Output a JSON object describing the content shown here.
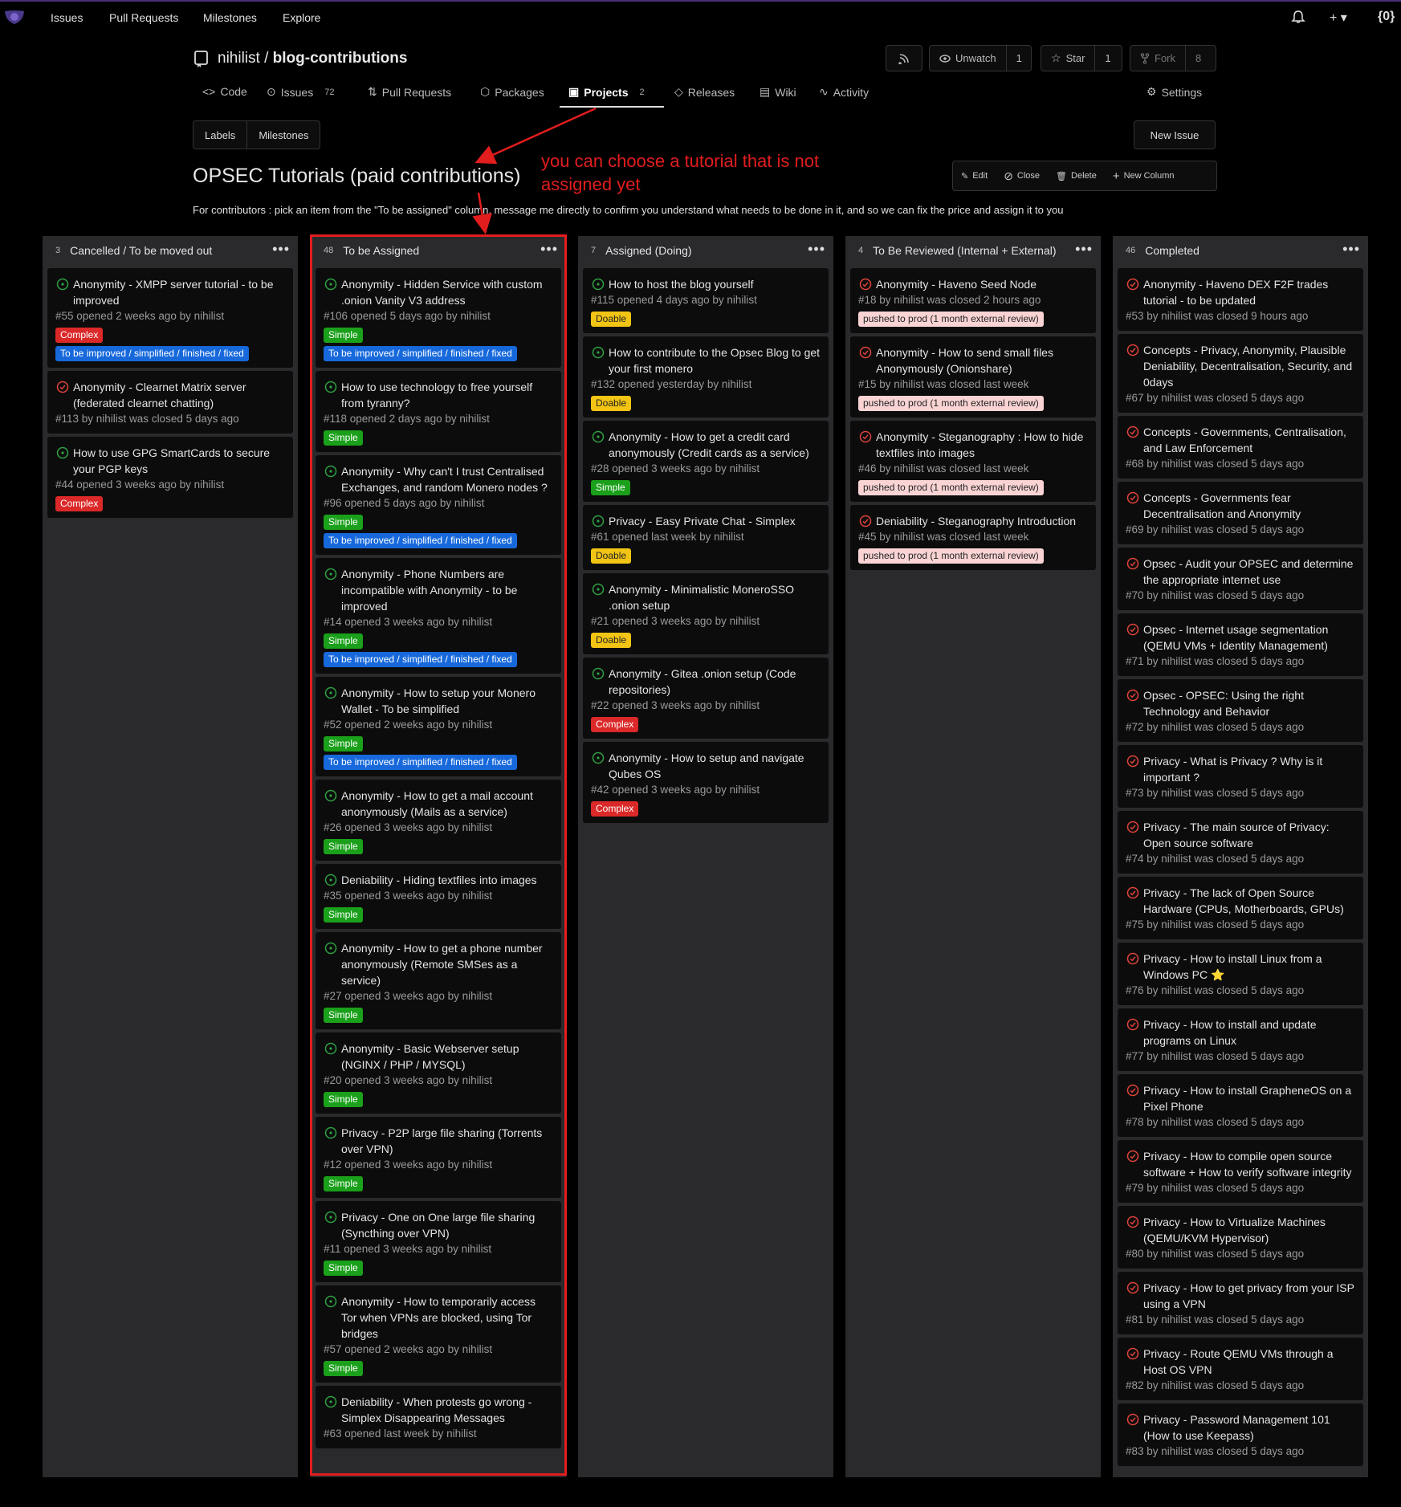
{
  "nav": {
    "items": [
      "Issues",
      "Pull Requests",
      "Milestones",
      "Explore"
    ],
    "right": {
      "bell": "bell-icon",
      "plus": "+ ▾",
      "profile": "{0}"
    }
  },
  "repo": {
    "owner": "nihilist",
    "name": "blog-contributions",
    "rss": "rss-icon",
    "unwatch_label": "Unwatch",
    "unwatch_count": "1",
    "star_label": "Star",
    "star_count": "1",
    "fork_label": "Fork",
    "fork_count": "8"
  },
  "tabs": {
    "code": "Code",
    "issues": "Issues",
    "issues_count": "72",
    "pulls": "Pull Requests",
    "packages": "Packages",
    "projects": "Projects",
    "projects_count": "2",
    "releases": "Releases",
    "wiki": "Wiki",
    "activity": "Activity",
    "settings": "Settings"
  },
  "subnav": {
    "labels": "Labels",
    "milestones": "Milestones",
    "new_issue": "New Issue"
  },
  "project": {
    "title": "OPSEC Tutorials (paid contributions)",
    "actions": {
      "edit": "Edit",
      "close": "Close",
      "delete": "Delete",
      "new_column": "New Column"
    },
    "description": "For contributors : pick an item from the \"To be assigned\" column, message me directly to confirm you understand what needs to be done in it, and so we can fix the price and assign it to you"
  },
  "annotation": "you can choose a tutorial that is not assigned yet",
  "columns": [
    {
      "count": "3",
      "title": "Cancelled / To be moved out",
      "cards": [
        {
          "state": "open",
          "title": "Anonymity - XMPP server tutorial - to be improved",
          "meta": "#55 opened 2 weeks ago by nihilist",
          "labels": [
            {
              "text": "Complex",
              "kind": "complex"
            },
            {
              "text": "To be improved / simplified / finished / fixed",
              "kind": "improve"
            }
          ]
        },
        {
          "state": "closed",
          "title": "Anonymity - Clearnet Matrix server (federated clearnet chatting)",
          "meta": "#113 by nihilist was closed 5 days ago",
          "labels": []
        },
        {
          "state": "open",
          "title": "How to use GPG SmartCards to secure your PGP keys",
          "meta": "#44 opened 3 weeks ago by nihilist",
          "labels": [
            {
              "text": "Complex",
              "kind": "complex"
            }
          ]
        }
      ]
    },
    {
      "count": "48",
      "title": "To be Assigned",
      "cards": [
        {
          "state": "open",
          "title": "Anonymity - Hidden Service with custom .onion Vanity V3 address",
          "meta": "#106 opened 5 days ago by nihilist",
          "labels": [
            {
              "text": "Simple",
              "kind": "simple"
            },
            {
              "text": "To be improved / simplified / finished / fixed",
              "kind": "improve"
            }
          ]
        },
        {
          "state": "open",
          "title": "How to use technology to free yourself from tyranny?",
          "meta": "#118 opened 2 days ago by nihilist",
          "labels": [
            {
              "text": "Simple",
              "kind": "simple"
            }
          ]
        },
        {
          "state": "open",
          "title": "Anonymity - Why can't I trust Centralised Exchanges, and random Monero nodes ?",
          "meta": "#96 opened 5 days ago by nihilist",
          "labels": [
            {
              "text": "Simple",
              "kind": "simple"
            },
            {
              "text": "To be improved / simplified / finished / fixed",
              "kind": "improve"
            }
          ]
        },
        {
          "state": "open",
          "title": "Anonymity - Phone Numbers are incompatible with Anonymity - to be improved",
          "meta": "#14 opened 3 weeks ago by nihilist",
          "labels": [
            {
              "text": "Simple",
              "kind": "simple"
            },
            {
              "text": "To be improved / simplified / finished / fixed",
              "kind": "improve"
            }
          ]
        },
        {
          "state": "open",
          "title": "Anonymity - How to setup your Monero Wallet - To be simplified",
          "meta": "#52 opened 2 weeks ago by nihilist",
          "labels": [
            {
              "text": "Simple",
              "kind": "simple"
            },
            {
              "text": "To be improved / simplified / finished / fixed",
              "kind": "improve"
            }
          ]
        },
        {
          "state": "open",
          "title": "Anonymity - How to get a mail account anonymously (Mails as a service)",
          "meta": "#26 opened 3 weeks ago by nihilist",
          "labels": [
            {
              "text": "Simple",
              "kind": "simple"
            }
          ]
        },
        {
          "state": "open",
          "title": "Deniability - Hiding textfiles into images",
          "meta": "#35 opened 3 weeks ago by nihilist",
          "labels": [
            {
              "text": "Simple",
              "kind": "simple"
            }
          ]
        },
        {
          "state": "open",
          "title": "Anonymity - How to get a phone number anonymously (Remote SMSes as a service)",
          "meta": "#27 opened 3 weeks ago by nihilist",
          "labels": [
            {
              "text": "Simple",
              "kind": "simple"
            }
          ]
        },
        {
          "state": "open",
          "title": "Anonymity - Basic Webserver setup (NGINX / PHP / MYSQL)",
          "meta": "#20 opened 3 weeks ago by nihilist",
          "labels": [
            {
              "text": "Simple",
              "kind": "simple"
            }
          ]
        },
        {
          "state": "open",
          "title": "Privacy - P2P large file sharing (Torrents over VPN)",
          "meta": "#12 opened 3 weeks ago by nihilist",
          "labels": [
            {
              "text": "Simple",
              "kind": "simple"
            }
          ]
        },
        {
          "state": "open",
          "title": "Privacy - One on One large file sharing (Syncthing over VPN)",
          "meta": "#11 opened 3 weeks ago by nihilist",
          "labels": [
            {
              "text": "Simple",
              "kind": "simple"
            }
          ]
        },
        {
          "state": "open",
          "title": "Anonymity - How to temporarily access Tor when VPNs are blocked, using Tor bridges",
          "meta": "#57 opened 2 weeks ago by nihilist",
          "labels": [
            {
              "text": "Simple",
              "kind": "simple"
            }
          ]
        },
        {
          "state": "open",
          "title": "Deniability - When protests go wrong - Simplex Disappearing Messages",
          "meta": "#63 opened last week by nihilist",
          "labels": []
        }
      ]
    },
    {
      "count": "7",
      "title": "Assigned (Doing)",
      "cards": [
        {
          "state": "open",
          "title": "How to host the blog yourself",
          "meta": "#115 opened 4 days ago by nihilist",
          "labels": [
            {
              "text": "Doable",
              "kind": "doable"
            }
          ]
        },
        {
          "state": "open",
          "title": "How to contribute to the Opsec Blog to get your first monero",
          "meta": "#132 opened yesterday by nihilist",
          "labels": [
            {
              "text": "Doable",
              "kind": "doable"
            }
          ]
        },
        {
          "state": "open",
          "title": "Anonymity - How to get a credit card anonymously (Credit cards as a service)",
          "meta": "#28 opened 3 weeks ago by nihilist",
          "labels": [
            {
              "text": "Simple",
              "kind": "simple"
            }
          ]
        },
        {
          "state": "open",
          "title": "Privacy - Easy Private Chat - Simplex",
          "meta": "#61 opened last week by nihilist",
          "labels": [
            {
              "text": "Doable",
              "kind": "doable"
            }
          ]
        },
        {
          "state": "open",
          "title": "Anonymity - Minimalistic MoneroSSO .onion setup",
          "meta": "#21 opened 3 weeks ago by nihilist",
          "labels": [
            {
              "text": "Doable",
              "kind": "doable"
            }
          ]
        },
        {
          "state": "open",
          "title": "Anonymity - Gitea .onion setup (Code repositories)",
          "meta": "#22 opened 3 weeks ago by nihilist",
          "labels": [
            {
              "text": "Complex",
              "kind": "complex"
            }
          ]
        },
        {
          "state": "open",
          "title": "Anonymity - How to setup and navigate Qubes OS",
          "meta": "#42 opened 3 weeks ago by nihilist",
          "labels": [
            {
              "text": "Complex",
              "kind": "complex"
            }
          ]
        }
      ]
    },
    {
      "count": "4",
      "title": "To Be Reviewed (Internal + External)",
      "cards": [
        {
          "state": "closed",
          "title": "Anonymity - Haveno Seed Node",
          "meta": "#18 by nihilist was closed 2 hours ago",
          "labels": [
            {
              "text": "pushed to prod (1 month external review)",
              "kind": "prod"
            }
          ]
        },
        {
          "state": "closed",
          "title": "Anonymity - How to send small files Anonymously (Onionshare)",
          "meta": "#15 by nihilist was closed last week",
          "labels": [
            {
              "text": "pushed to prod (1 month external review)",
              "kind": "prod"
            }
          ]
        },
        {
          "state": "closed",
          "title": "Anonymity - Steganography : How to hide textfiles into images",
          "meta": "#46 by nihilist was closed last week",
          "labels": [
            {
              "text": "pushed to prod (1 month external review)",
              "kind": "prod"
            }
          ]
        },
        {
          "state": "closed",
          "title": "Deniability - Steganography Introduction",
          "meta": "#45 by nihilist was closed last week",
          "labels": [
            {
              "text": "pushed to prod (1 month external review)",
              "kind": "prod"
            }
          ]
        }
      ]
    },
    {
      "count": "46",
      "title": "Completed",
      "cards": [
        {
          "state": "closed",
          "title": "Anonymity - Haveno DEX F2F trades tutorial - to be updated",
          "meta": "#53 by nihilist was closed 9 hours ago",
          "labels": []
        },
        {
          "state": "closed",
          "title": "Concepts - Privacy, Anonymity, Plausible Deniability, Decentralisation, Security, and 0days",
          "meta": "#67 by nihilist was closed 5 days ago",
          "labels": []
        },
        {
          "state": "closed",
          "title": "Concepts - Governments, Centralisation, and Law Enforcement",
          "meta": "#68 by nihilist was closed 5 days ago",
          "labels": []
        },
        {
          "state": "closed",
          "title": "Concepts - Governments fear Decentralisation and Anonymity",
          "meta": "#69 by nihilist was closed 5 days ago",
          "labels": []
        },
        {
          "state": "closed",
          "title": "Opsec - Audit your OPSEC and determine the appropriate internet use",
          "meta": "#70 by nihilist was closed 5 days ago",
          "labels": []
        },
        {
          "state": "closed",
          "title": "Opsec - Internet usage segmentation (QEMU VMs + Identity Management)",
          "meta": "#71 by nihilist was closed 5 days ago",
          "labels": []
        },
        {
          "state": "closed",
          "title": "Opsec - OPSEC: Using the right Technology and Behavior",
          "meta": "#72 by nihilist was closed 5 days ago",
          "labels": []
        },
        {
          "state": "closed",
          "title": "Privacy - What is Privacy ? Why is it important ?",
          "meta": "#73 by nihilist was closed 5 days ago",
          "labels": []
        },
        {
          "state": "closed",
          "title": "Privacy - The main source of Privacy: Open source software",
          "meta": "#74 by nihilist was closed 5 days ago",
          "labels": []
        },
        {
          "state": "closed",
          "title": "Privacy - The lack of Open Source Hardware (CPUs, Motherboards, GPUs)",
          "meta": "#75 by nihilist was closed 5 days ago",
          "labels": []
        },
        {
          "state": "closed",
          "title": "Privacy - How to install Linux from a Windows PC ⭐",
          "meta": "#76 by nihilist was closed 5 days ago",
          "labels": []
        },
        {
          "state": "closed",
          "title": "Privacy - How to install and update programs on Linux",
          "meta": "#77 by nihilist was closed 5 days ago",
          "labels": []
        },
        {
          "state": "closed",
          "title": "Privacy - How to install GrapheneOS on a Pixel Phone",
          "meta": "#78 by nihilist was closed 5 days ago",
          "labels": []
        },
        {
          "state": "closed",
          "title": "Privacy - How to compile open source software + How to verify software integrity",
          "meta": "#79 by nihilist was closed 5 days ago",
          "labels": []
        },
        {
          "state": "closed",
          "title": "Privacy - How to Virtualize Machines (QEMU/KVM Hypervisor)",
          "meta": "#80 by nihilist was closed 5 days ago",
          "labels": []
        },
        {
          "state": "closed",
          "title": "Privacy - How to get privacy from your ISP using a VPN",
          "meta": "#81 by nihilist was closed 5 days ago",
          "labels": []
        },
        {
          "state": "closed",
          "title": "Privacy - Route QEMU VMs through a Host OS VPN",
          "meta": "#82 by nihilist was closed 5 days ago",
          "labels": []
        },
        {
          "state": "closed",
          "title": "Privacy - Password Management 101 (How to use Keepass)",
          "meta": "#83 by nihilist was closed 5 days ago",
          "labels": []
        }
      ]
    }
  ]
}
